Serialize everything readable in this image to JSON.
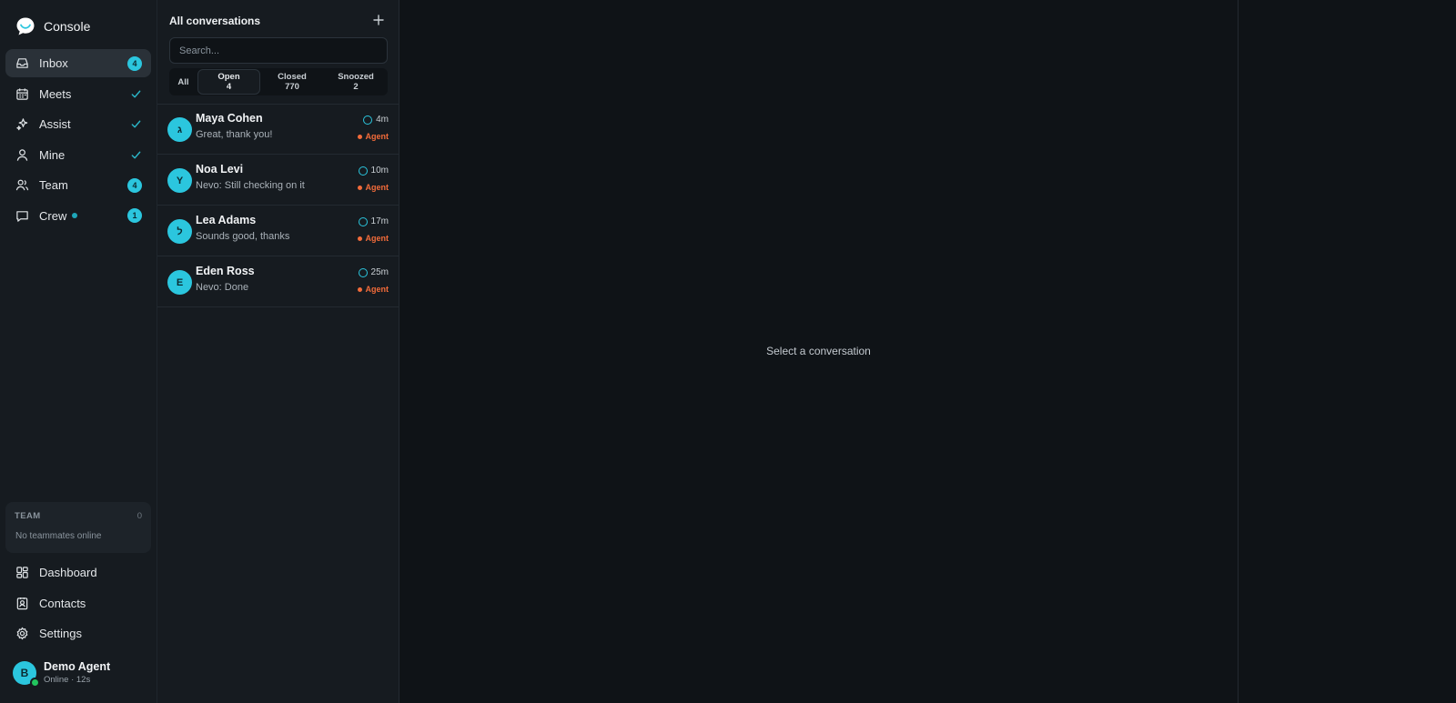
{
  "brand": {
    "name": "Console"
  },
  "nav": [
    {
      "label": "Inbox",
      "icon": "inbox-icon",
      "badge": "4",
      "active": true
    },
    {
      "label": "Meets",
      "icon": "calendar-icon",
      "check": true
    },
    {
      "label": "Assist",
      "icon": "sparkles-icon",
      "check": true
    },
    {
      "label": "Mine",
      "icon": "user-icon",
      "check": true
    },
    {
      "label": "Team",
      "icon": "users-icon",
      "badge": "4"
    },
    {
      "label": "Crew",
      "icon": "chat-icon",
      "badge": "1",
      "live": true
    }
  ],
  "team_panel": {
    "title": "TEAM",
    "count": "0",
    "empty": "No teammates online"
  },
  "bottom_nav": [
    {
      "label": "Dashboard",
      "icon": "dashboard-icon"
    },
    {
      "label": "Contacts",
      "icon": "contacts-icon"
    },
    {
      "label": "Settings",
      "icon": "gear-icon"
    }
  ],
  "user": {
    "initial": "B",
    "name": "Demo Agent",
    "status": "Online · 12s"
  },
  "list": {
    "title": "All conversations",
    "search_placeholder": "Search...",
    "tabs": [
      {
        "label": "All",
        "count": ""
      },
      {
        "label": "Open",
        "count": "4"
      },
      {
        "label": "Closed",
        "count": "770"
      },
      {
        "label": "Snoozed",
        "count": "2"
      }
    ],
    "conversations": [
      {
        "initial": "ג",
        "name": "Maya Cohen",
        "preview": "Great, thank you!",
        "time": "4m",
        "assignee": "Agent"
      },
      {
        "initial": "Y",
        "name": "Noa Levi",
        "preview": "Nevo: Still checking on it",
        "time": "10m",
        "assignee": "Agent"
      },
      {
        "initial": "ל",
        "name": "Lea Adams",
        "preview": "Sounds good, thanks",
        "time": "17m",
        "assignee": "Agent"
      },
      {
        "initial": "E",
        "name": "Eden Ross",
        "preview": "Nevo: Done",
        "time": "25m",
        "assignee": "Agent"
      }
    ]
  },
  "main": {
    "empty_text": "Select a conversation"
  },
  "colors": {
    "accent": "#2bc6de",
    "agent": "#f26b3a",
    "online": "#22c55e",
    "check": "#2bb7c9"
  }
}
